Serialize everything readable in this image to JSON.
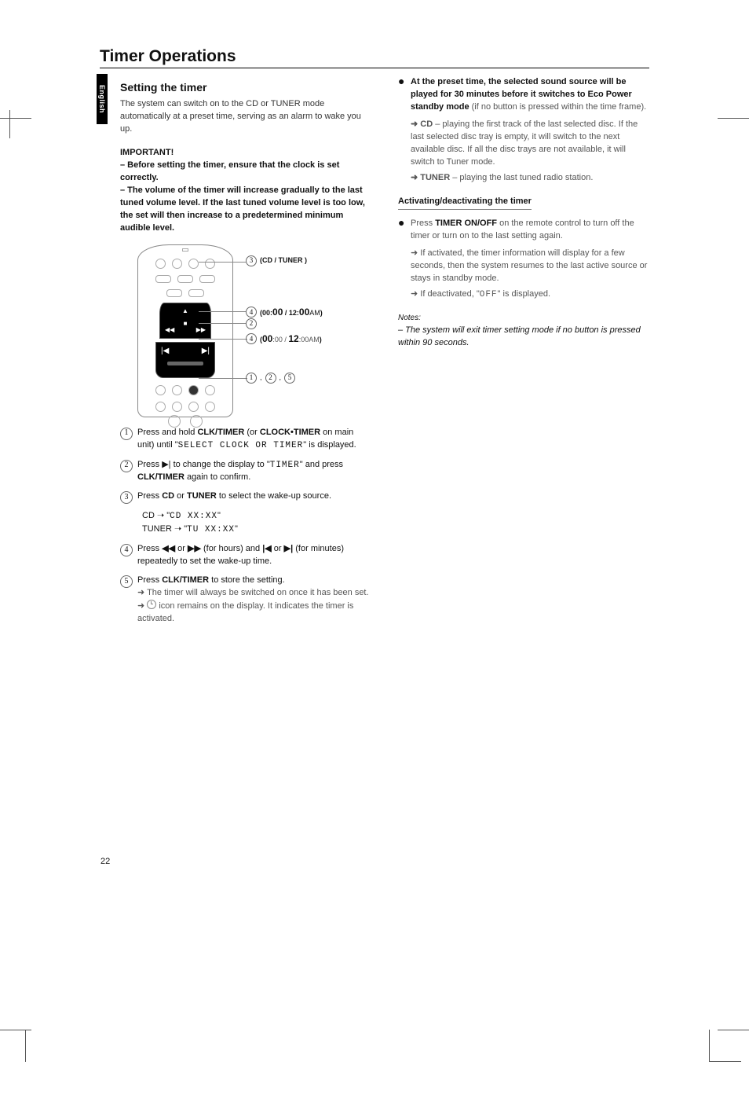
{
  "lang_tab": "English",
  "chapter_title": "Timer Operations",
  "page_number": "22",
  "section_setting_title": "Setting the timer",
  "setting_body": "The system can switch on to the CD or TUNER mode automatically at a preset time, serving as an alarm to wake you up.",
  "important_head": "IMPORTANT!",
  "important_line1": "– Before setting the timer, ensure that the clock is set correctly.",
  "important_line2": "– The volume of the timer will increase gradually to the last tuned volume level. If the last tuned volume level is too low, the set will then increase to a predetermined minimum audible level.",
  "remote": {
    "callout_a_num": "3",
    "callout_a_label": "(CD / TUNER )",
    "callout_b_num": "4",
    "callout_b1": "(00:",
    "callout_b2": "00",
    "callout_b3": " / 12:",
    "callout_b4": "00",
    "callout_b5": "AM",
    "callout_b6": ")",
    "callout_c_num": "2",
    "callout_d_num": "4",
    "callout_d1": "(",
    "callout_d2": "00",
    "callout_d3": ":00 / ",
    "callout_d4": "12",
    "callout_d5": ":00AM",
    "callout_d6": ")",
    "callout_e1": "1",
    "callout_e2": "2",
    "callout_e3": "5"
  },
  "step1_num": "1",
  "step1a": "Press and hold ",
  "step1b": "CLK/TIMER",
  "step1c": " (or ",
  "step1d": "CLOCK•TIMER",
  "step1e": " on main unit) until \"",
  "step1f": "SELECT CLOCK OR TIMER",
  "step1g": "\" is displayed.",
  "step2_num": "2",
  "step2a": "Press ",
  "step2sym": "▶|",
  "step2b": " to change the display to \"",
  "step2c": "TIMER",
  "step2d": "\" and press ",
  "step2e": "CLK/TIMER",
  "step2f": " again to confirm.",
  "step3_num": "3",
  "step3a": "Press ",
  "step3b": "CD",
  "step3c": " or ",
  "step3d": "TUNER",
  "step3e": " to select the wake-up source.",
  "step3_cd_a": "CD ➝  \"",
  "step3_cd_b": "CD XX:XX",
  "step3_cd_c": "\"",
  "step3_tu_a": "TUNER ➝   \"",
  "step3_tu_b": "TU XX:XX",
  "step3_tu_c": "\"",
  "step4_num": "4",
  "step4a": "Press ",
  "step4b": "◀◀",
  "step4c": " or ",
  "step4d": "▶▶",
  "step4e": " (for hours) and ",
  "step4f": "|◀",
  "step4g": " or ",
  "step4h": "▶|",
  "step4i": " (for minutes) repeatedly to set the wake-up time.",
  "step5_num": "5",
  "step5a": "Press ",
  "step5b": "CLK/TIMER",
  "step5c": " to store the setting.",
  "step5_r1": "➜ The timer will always be switched on once it has been set.",
  "step5_r2a": "➜ ",
  "step5_r2b": " icon remains on the display. It indicates the timer is activated.",
  "right_bullet_bold": "At the preset time, the selected sound source will be played for 30 minutes before it switches to Eco Power standby mode",
  "right_bullet_tail": " (if no button is pressed within the time frame).",
  "right_cd_a": "➜ CD",
  "right_cd_b": " – playing the first track of the last selected disc.  If the last selected disc tray is empty, it will switch to the next available disc.  If all the disc trays are not available, it will switch to Tuner mode.",
  "right_tuner_a": "➜ TUNER",
  "right_tuner_b": " – playing the last tuned radio station.",
  "activating_title": "Activating/deactivating the timer",
  "activ_step_a": "Press ",
  "activ_step_b": "TIMER ON/OFF",
  "activ_step_c": " on the remote control to turn off the timer or turn on to the last setting again.",
  "activ_r1": "➜ If activated, the timer information will display for a few seconds, then the system resumes to the last active source or stays in standby mode.",
  "activ_r2a": "➜ If deactivated, \"",
  "activ_r2b": "OFF",
  "activ_r2c": "\" is displayed.",
  "notes_head": "Notes:",
  "notes_body": "– The system will exit timer setting mode if no button is pressed within 90 seconds."
}
